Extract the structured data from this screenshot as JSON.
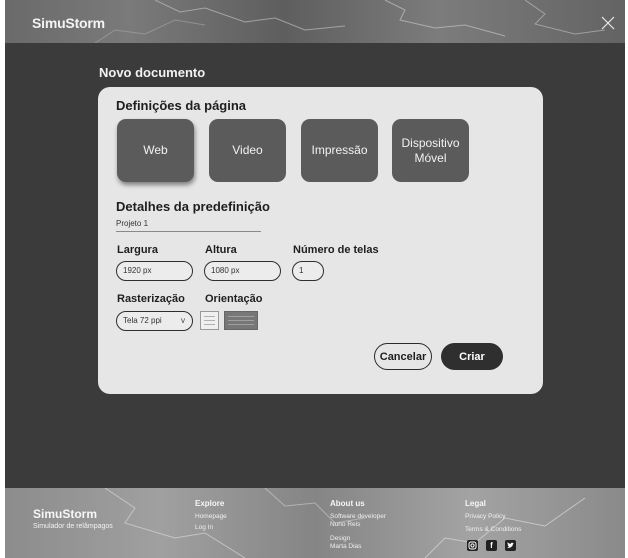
{
  "header": {
    "brand": "SimuStorm"
  },
  "page": {
    "title": "Novo documento"
  },
  "dialog": {
    "page_settings_title": "Definições da página",
    "presets": [
      {
        "label": "Web",
        "selected": true
      },
      {
        "label": "Video",
        "selected": false
      },
      {
        "label": "Impressão",
        "selected": false
      },
      {
        "label": "Dispositivo Móvel",
        "selected": false
      }
    ],
    "preset_details_title": "Detalhes da predefinição",
    "preset_name": "Projeto 1",
    "width": {
      "label": "Largura",
      "value": "1920 px"
    },
    "height": {
      "label": "Altura",
      "value": "1080 px"
    },
    "screens": {
      "label": "Número de telas",
      "value": "1"
    },
    "rasterization": {
      "label": "Rasterização",
      "value": "Tela 72 ppi",
      "caret": "v"
    },
    "orientation": {
      "label": "Orientação",
      "selected": "landscape"
    },
    "cancel_label": "Cancelar",
    "create_label": "Criar"
  },
  "footer": {
    "brand": "SimuStorm",
    "tagline": "Simulador de relâmpagos",
    "explore": {
      "title": "Explore",
      "links": [
        "Homepage",
        "Log In"
      ]
    },
    "about": {
      "title": "About us",
      "role1": "Software developer",
      "name1": "Nuno Reis",
      "role2": "Design",
      "name2": "Marta Dias"
    },
    "legal": {
      "title": "Legal",
      "links": [
        "Privacy Policy",
        "Terms & Conditions"
      ]
    },
    "social_icons": [
      "instagram-icon",
      "facebook-icon",
      "twitter-icon"
    ]
  },
  "colors": {
    "background": "#3b3b3b",
    "card": "#e6e6e6",
    "preset_tile": "#5b5b5b",
    "primary_button": "#2f2f2f"
  }
}
